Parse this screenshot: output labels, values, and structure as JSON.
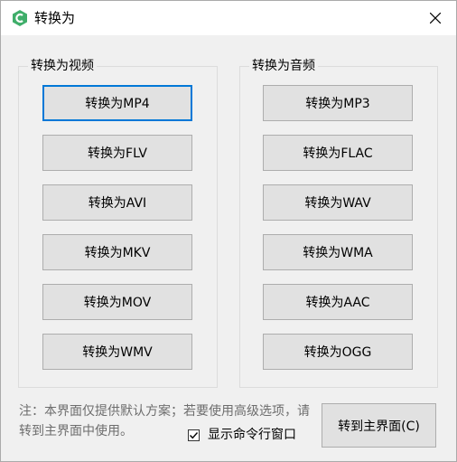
{
  "window": {
    "title": "转换为"
  },
  "video_group": {
    "label": "转换为视频",
    "buttons": [
      "转换为MP4",
      "转换为FLV",
      "转换为AVI",
      "转换为MKV",
      "转换为MOV",
      "转换为WMV"
    ]
  },
  "audio_group": {
    "label": "转换为音频",
    "buttons": [
      "转换为MP3",
      "转换为FLAC",
      "转换为WAV",
      "转换为WMA",
      "转换为AAC",
      "转换为OGG"
    ]
  },
  "footer": {
    "note": "注：本界面仅提供默认方案；若要使用高级选项，请转到主界面中使用。",
    "show_cmd_label": "显示命令行窗口",
    "show_cmd_checked": true,
    "main_button": "转到主界面(C)"
  },
  "colors": {
    "accent": "#0078d7",
    "app_icon": "#3fae6a"
  },
  "icons": {
    "app": "app-logo-icon",
    "close": "close-icon",
    "check": "checkmark-icon"
  }
}
